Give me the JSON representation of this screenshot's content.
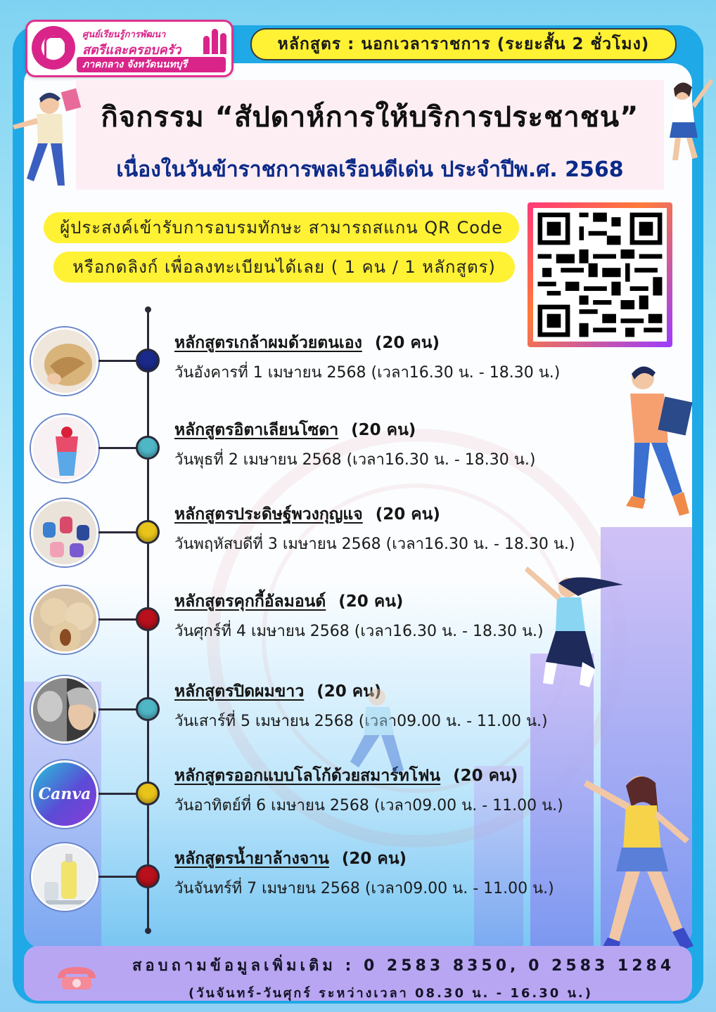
{
  "logo": {
    "line1": "ศูนย์เรียนรู้การพัฒนา",
    "line2": "สตรีและครอบครัว",
    "line3": "ภาคกลาง จังหวัดนนทบุรี"
  },
  "course_type": "หลักสูตร : นอกเวลาราชการ (ระยะสั้น 2 ชั่วโมง)",
  "title": "กิจกรรม “สัปดาห์การให้บริการประชาชน”",
  "subtitle": "เนื่องในวันข้าราชการพลเรือนดีเด่น ประจำปีพ.ศ. 2568",
  "registration": {
    "line1": "ผู้ประสงค์เข้ารับการอบรมทักษะ สามารถสแกน QR Code",
    "line2": "หรือกดลิงก์ เพื่อลงทะเบียนได้เลย ( 1 คน / 1 หลักสูตร)"
  },
  "courses": [
    {
      "title": "หลักสูตรเกล้าผมด้วยตนเอง",
      "count": "(20 คน)",
      "date": "วันอังคารที่ 1 เมษายน 2568 (เวลา16.30 น. - 18.30 น.)",
      "node_color": "#1b2a8a",
      "image": "hair-bun-photo"
    },
    {
      "title": "หลักสูตรอิตาเลียนโซดา",
      "count": "(20 คน)",
      "date": "วันพุธที่ 2 เมษายน 2568 (เวลา16.30 น. - 18.30 น.)",
      "node_color": "#4fb6c6",
      "image": "italian-soda-photo"
    },
    {
      "title": "หลักสูตรประดิษฐ์พวงกุญแจ",
      "count": "(20 คน)",
      "date": "วันพฤหัสบดีที่ 3 เมษายน 2568 (เวลา16.30 น. - 18.30 น.)",
      "node_color": "#e8c41a",
      "image": "keychain-photo"
    },
    {
      "title": "หลักสูตรคุกกี้อัลมอนด์",
      "count": "(20 คน)",
      "date": "วันศุกร์ที่ 4 เมษายน 2568 (เวลา16.30 น. - 18.30 น.)",
      "node_color": "#b8101c",
      "image": "almond-cookie-photo"
    },
    {
      "title": "หลักสูตรปิดผมขาว",
      "count": "(20 คน)",
      "date": "วันเสาร์ที่ 5 เมษายน 2568 (เวลา09.00 น. - 11.00 น.)",
      "node_color": "#4fb6c6",
      "image": "grey-hair-photo"
    },
    {
      "title": "หลักสูตรออกแบบโลโก้ด้วยสมาร์ทโฟน",
      "count": "(20 คน)",
      "date": "วันอาทิตย์ที่ 6 เมษายน 2568 (เวลา09.00 น. - 11.00 น.)",
      "node_color": "#e8c41a",
      "image": "canva-logo",
      "image_text": "Canva"
    },
    {
      "title": "หลักสูตรน้ำยาล้างจาน",
      "count": "(20 คน)",
      "date": "วันจันทร์ที่ 7 เมษายน 2568 (เวลา09.00 น. - 11.00 น.)",
      "node_color": "#b8101c",
      "image": "dish-soap-photo"
    }
  ],
  "contact": {
    "line1": "สอบถามข้อมูลเพิ่มเติม :  0 2583 8350, 0 2583 1284",
    "line2": "(วันจันทร์-วันศุกร์ ระหว่างเวลา 08.30 น. - 16.30 น.)"
  },
  "colors": {
    "frame": "#1fa9e6",
    "highlight_yellow": "#fff133",
    "logo_pink": "#d9258a",
    "subtitle_blue": "#0b2a88",
    "footer": "#b9a6f2"
  }
}
